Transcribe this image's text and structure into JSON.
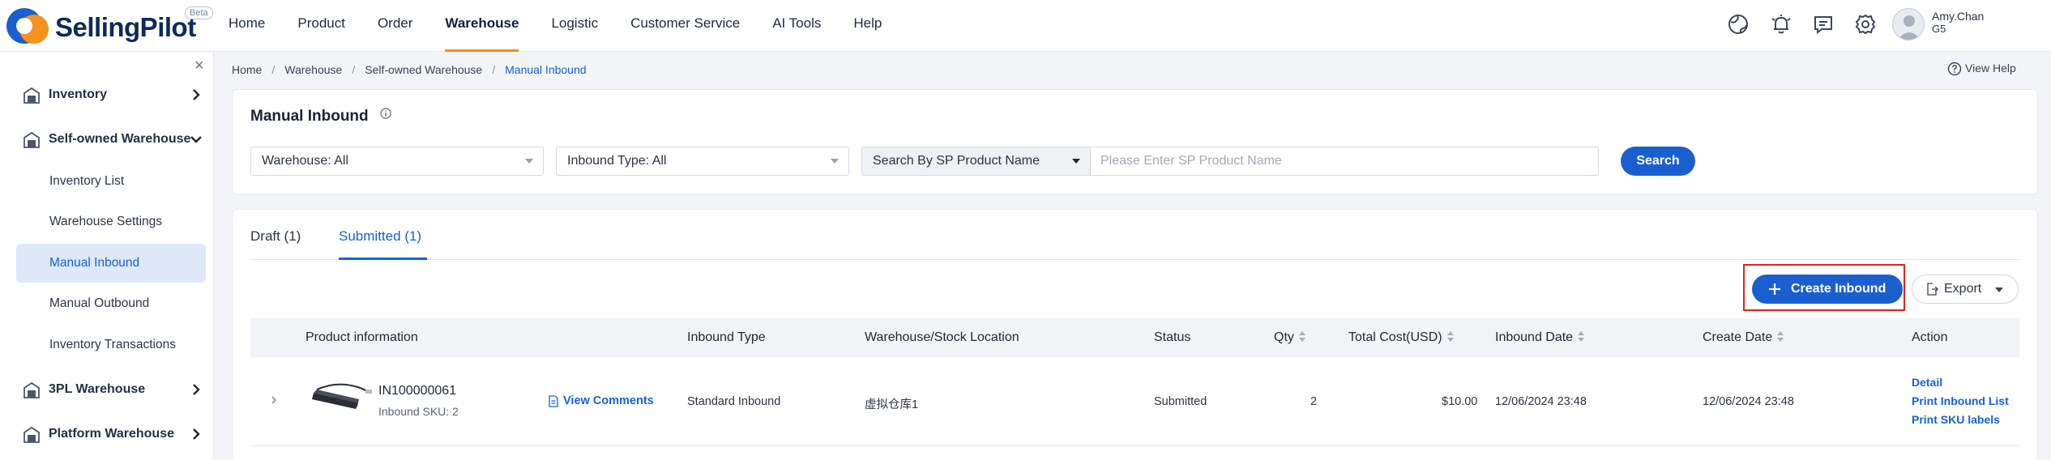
{
  "app": {
    "name": "SellingPilot",
    "badge": "Beta"
  },
  "nav": {
    "items": [
      "Home",
      "Product",
      "Order",
      "Warehouse",
      "Logistic",
      "Customer Service",
      "AI Tools",
      "Help"
    ],
    "active": "Warehouse"
  },
  "user": {
    "name": "Amy.Chan",
    "sub": "G5"
  },
  "sidebar": {
    "groups": [
      {
        "label": "Inventory",
        "icon": "warehouse-icon",
        "expanded": false
      },
      {
        "label": "Self-owned Warehouse",
        "icon": "warehouse-icon",
        "expanded": true
      },
      {
        "label": "3PL Warehouse",
        "icon": "warehouse-icon",
        "expanded": false
      },
      {
        "label": "Platform Warehouse",
        "icon": "warehouse-icon",
        "expanded": false
      }
    ],
    "subitems": [
      "Inventory List",
      "Warehouse Settings",
      "Manual Inbound",
      "Manual Outbound",
      "Inventory Transactions"
    ],
    "active_subitem": "Manual Inbound"
  },
  "breadcrumb": [
    "Home",
    "Warehouse",
    "Self-owned Warehouse",
    "Manual Inbound"
  ],
  "help": {
    "label": "View Help"
  },
  "page": {
    "title": "Manual Inbound"
  },
  "filters": {
    "warehouse": "Warehouse: All",
    "inbound_type": "Inbound Type: All",
    "search_by": "Search By SP Product Name",
    "search_placeholder": "Please Enter SP Product Name",
    "search_button": "Search"
  },
  "tabs": [
    {
      "label": "Draft (1)",
      "active": false
    },
    {
      "label": "Submitted (1)",
      "active": true
    }
  ],
  "actions": {
    "create": "Create Inbound",
    "export": "Export"
  },
  "table": {
    "columns": [
      "Product information",
      "Inbound Type",
      "Warehouse/Stock Location",
      "Status",
      "Qty",
      "Total Cost(USD)",
      "Inbound Date",
      "Create Date",
      "Action"
    ],
    "rows": [
      {
        "id": "IN100000061",
        "sku": "Inbound SKU: 2",
        "comments_link": "View Comments",
        "inbound_type": "Standard Inbound",
        "location": "虚拟仓库1",
        "status": "Submitted",
        "qty": "2",
        "total_cost": "$10.00",
        "inbound_date": "12/06/2024 23:48",
        "create_date": "12/06/2024 23:48",
        "actions": [
          "Detail",
          "Print Inbound List",
          "Print SKU labels"
        ]
      }
    ]
  },
  "colors": {
    "primary": "#1a5fd0",
    "accent_underline": "#f08c1a",
    "highlight_border": "#e02020"
  }
}
